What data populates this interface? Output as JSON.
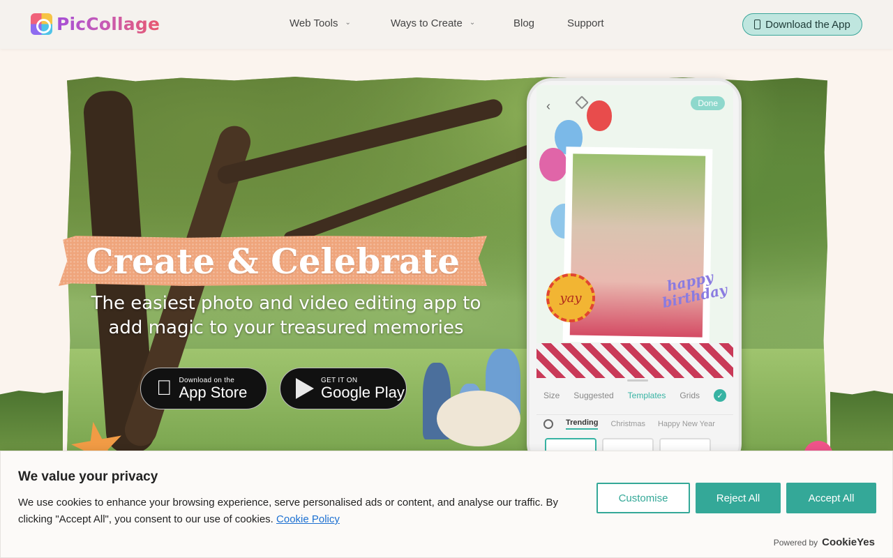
{
  "header": {
    "logo_text": "PicCollage",
    "nav": [
      {
        "label": "Web Tools",
        "has_dropdown": true
      },
      {
        "label": "Ways to Create",
        "has_dropdown": true
      },
      {
        "label": "Blog",
        "has_dropdown": false
      },
      {
        "label": "Support",
        "has_dropdown": false
      }
    ],
    "download_button": "Download the App"
  },
  "hero": {
    "title": "Create & Celebrate",
    "subtitle_line1": "The easiest photo and video editing app to",
    "subtitle_line2": "add magic to your treasured memories",
    "app_store": {
      "small": "Download on the",
      "big": "App Store",
      "icon": "apple-icon"
    },
    "google_play": {
      "small": "GET IT ON",
      "big": "Google Play",
      "icon": "play-icon"
    }
  },
  "phone": {
    "done_label": "Done",
    "sticker_yay": "yay",
    "sticker_happy_birthday": "happy birthday",
    "tabs": [
      "Size",
      "Suggested",
      "Templates",
      "Grids"
    ],
    "active_tab": "Templates",
    "subtabs": [
      "Trending",
      "Christmas",
      "Happy New Year"
    ],
    "active_subtab": "Trending"
  },
  "cookie": {
    "title": "We value your privacy",
    "text": "We use cookies to enhance your browsing experience, serve personalised ads or content, and analyse our traffic. By clicking \"Accept All\", you consent to our use of cookies.",
    "link": "Cookie Policy",
    "customise": "Customise",
    "reject": "Reject All",
    "accept": "Accept All",
    "powered_by": "Powered by",
    "brand": "CookieYes"
  },
  "colors": {
    "accent_teal": "#34a898",
    "download_bg": "#bfe6df",
    "title_tape": "#efa57c",
    "page_bg": "#fbf4ee"
  }
}
